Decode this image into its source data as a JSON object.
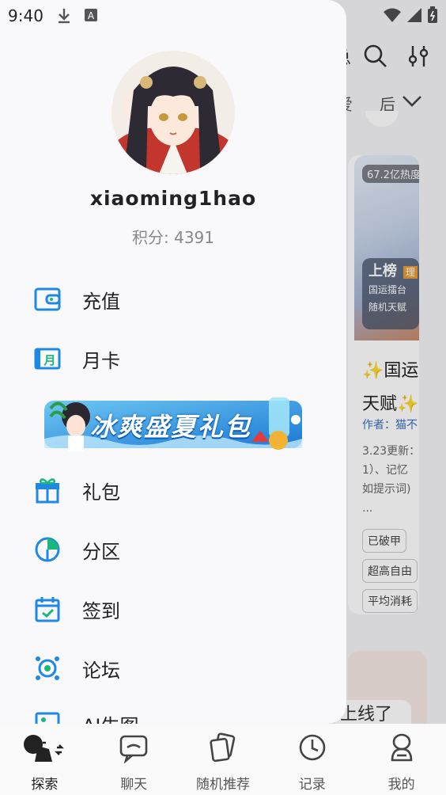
{
  "status_bar": {
    "time": "9:40"
  },
  "background": {
    "top_text": "总",
    "tabs": [
      "爱",
      "后"
    ],
    "card": {
      "hot_badge": "67.2亿热度",
      "rank_title": "上榜",
      "rank_tag": "理",
      "rank_lines": [
        "国运擂台",
        "随机天赋"
      ],
      "title": "✨国运天赋✨",
      "author": "作者：猫不",
      "desc_lines": [
        "3.23更新：",
        "1）、记忆",
        "如提示词)",
        "..."
      ],
      "tags": [
        "已破甲",
        "超高自由",
        "平均消耗"
      ]
    },
    "next_card_text": "上线了"
  },
  "drawer": {
    "username": "xiaoming1hao",
    "points": "积分: 4391",
    "menu": [
      {
        "label": "充值",
        "icon": "wallet-icon"
      },
      {
        "label": "月卡",
        "icon": "month-card-icon"
      },
      {
        "label": "礼包",
        "icon": "gift-icon"
      },
      {
        "label": "分区",
        "icon": "pie-chart-icon"
      },
      {
        "label": "签到",
        "icon": "calendar-check-icon"
      },
      {
        "label": "论坛",
        "icon": "forum-icon"
      },
      {
        "label": "AI生图",
        "icon": "image-icon"
      }
    ],
    "banner_text": "冰爽盛夏礼包",
    "month_card_glyph": "月"
  },
  "bottom_nav": [
    {
      "label": "探索",
      "icon": "explore-icon",
      "active": true
    },
    {
      "label": "聊天",
      "icon": "chat-icon",
      "active": false
    },
    {
      "label": "随机推荐",
      "icon": "random-cards-icon",
      "active": false
    },
    {
      "label": "记录",
      "icon": "clock-icon",
      "active": false
    },
    {
      "label": "我的",
      "icon": "profile-icon",
      "active": false
    }
  ],
  "colors": {
    "accent": "#1e88e5",
    "green": "#18b87a"
  }
}
